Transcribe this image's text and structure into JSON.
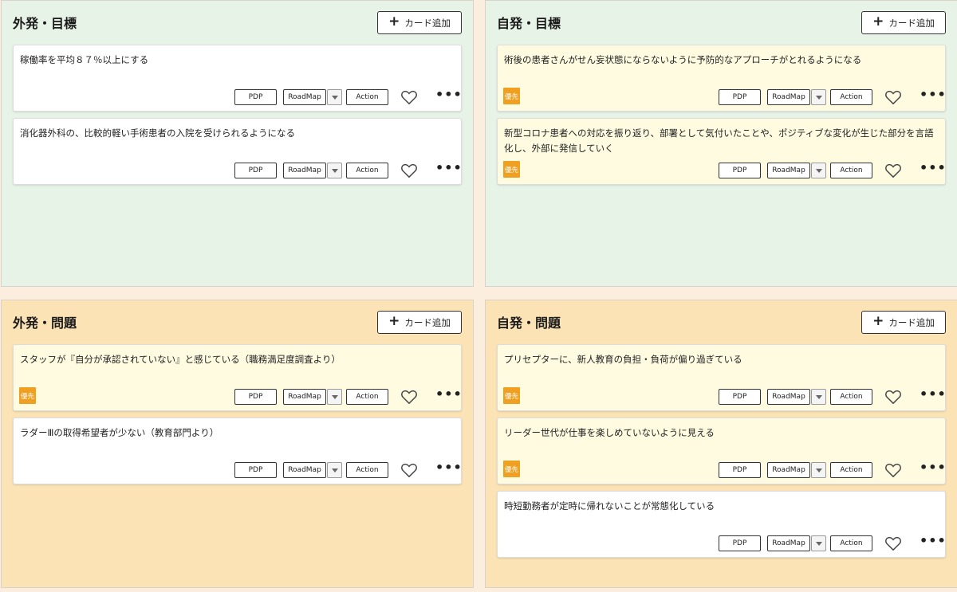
{
  "labels": {
    "add_card": "カード追加",
    "pdp": "PDP",
    "roadmap": "RoadMap",
    "action": "Action",
    "priority": "優先",
    "more": "•••"
  },
  "icons": [
    "plus-icon",
    "chevron-down-icon",
    "heart-icon",
    "more-icon"
  ],
  "colors": {
    "goal_bg": "#e8f3e8",
    "issue_bg": "#fbe3b6",
    "priority_card_bg": "#fffbe0",
    "badge": "#f0a020"
  },
  "quadrants": [
    {
      "title": "外発・目標",
      "cards": [
        {
          "text": "稼働率を平均８７％以上にする",
          "priority": false
        },
        {
          "text": "消化器外科の、比較的軽い手術患者の入院を受けられるようになる",
          "priority": false
        }
      ]
    },
    {
      "title": "自発・目標",
      "cards": [
        {
          "text": "術後の患者さんがせん妄状態にならないように予防的なアプローチがとれるようになる",
          "priority": true
        },
        {
          "text": "新型コロナ患者への対応を振り返り、部署として気付いたことや、ポジティブな変化が生じた部分を言語化し、外部に発信していく",
          "priority": true
        }
      ]
    },
    {
      "title": "外発・問題",
      "cards": [
        {
          "text": "スタッフが『自分が承認されていない』と感じている（職務満足度調査より）",
          "priority": true
        },
        {
          "text": "ラダーⅢの取得希望者が少ない（教育部門より）",
          "priority": false
        }
      ]
    },
    {
      "title": "自発・問題",
      "cards": [
        {
          "text": "プリセプターに、新人教育の負担・負荷が偏り過ぎている",
          "priority": true
        },
        {
          "text": "リーダー世代が仕事を楽しめていないように見える",
          "priority": true
        },
        {
          "text": "時短勤務者が定時に帰れないことが常態化している",
          "priority": false
        }
      ]
    }
  ]
}
